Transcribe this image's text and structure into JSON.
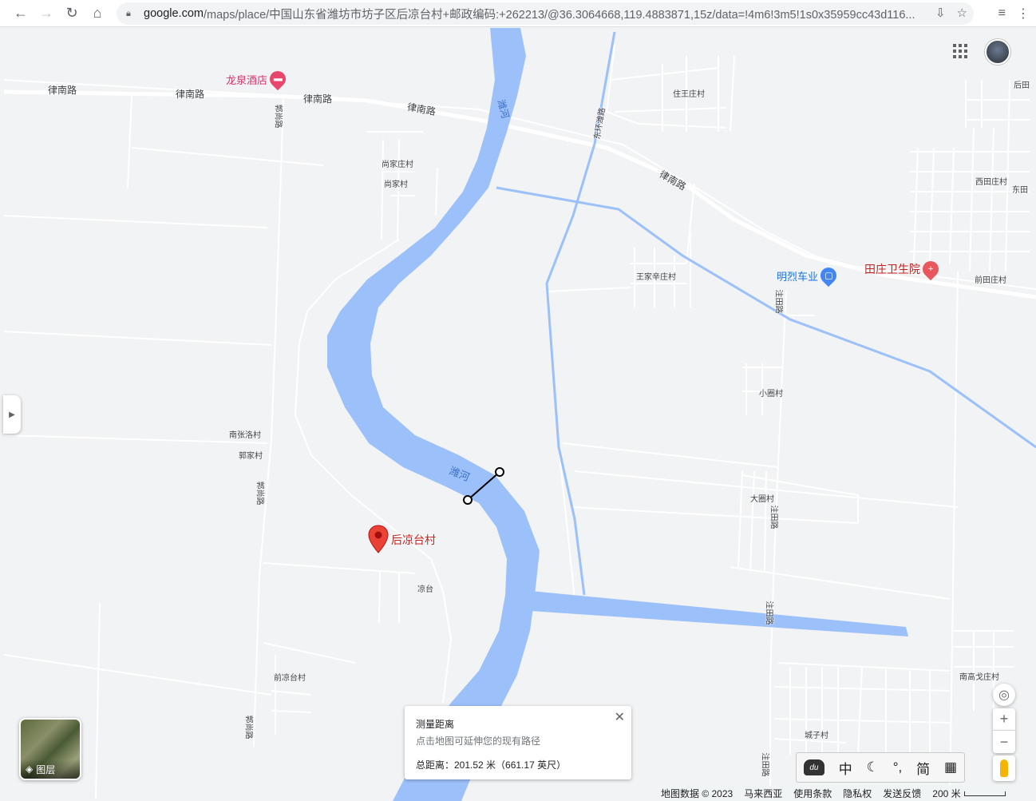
{
  "browser": {
    "url_host": "google.com",
    "url_path": "/maps/place/中国山东省潍坊市坊子区后凉台村+邮政编码:+262213/@36.3064668,119.4883871,15z/data=!4m6!3m5!1s0x35959cc43d116..."
  },
  "map": {
    "roads": {
      "lvnan_1": "律南路",
      "lvnan_2": "律南路",
      "lvnan_3": "律南路",
      "lvnan_4": "律南路",
      "lvnan_5": "律南路",
      "guoshang_1": "郭尚路",
      "guoshang_2": "郭尚路",
      "guoshang_3": "郭尚路",
      "donghuan": "东环潍路",
      "zhutian_1": "注田路",
      "zhutian_2": "注田路",
      "zhutian_3": "注田路",
      "zhutian_4": "注田路"
    },
    "water": {
      "weihe_1": "潍河",
      "weihe_2": "潍河"
    },
    "villages": {
      "zhuwangzhuang": "住王庄村",
      "shangjiazhuang": "尚家庄村",
      "shangjia": "尚家村",
      "houtian": "后田",
      "xitianzhuang": "西田庄村",
      "dongtian": "东田",
      "wangjiaxinzhuang": "王家辛庄村",
      "qiantianzhuang": "前田庄村",
      "xiaoquan": "小圈村",
      "nanzhangluo": "南张洛村",
      "guojia": "郭家村",
      "daquan": "大圈村",
      "liangtai": "凉台",
      "qianliangtai": "前凉台村",
      "nangaogezhuang": "南高戈庄村",
      "chengzi": "城子村"
    },
    "pois": {
      "longquan_hotel": "龙泉酒店",
      "minglie": "明烈车业",
      "tianzhuang_hospital": "田庄卫生院"
    },
    "selected_place": "后凉台村"
  },
  "measure": {
    "title": "测量距离",
    "hint": "点击地图可延伸您的现有路径",
    "total": "总距离：201.52 米（661.17 英尺）"
  },
  "controls": {
    "layers_label": "图层"
  },
  "ime": {
    "lang": "中",
    "punct": "°,",
    "simplified": "简"
  },
  "footer": {
    "map_data": "地图数据 © 2023",
    "region": "马来西亚",
    "terms": "使用条款",
    "privacy": "隐私权",
    "feedback": "发送反馈",
    "scale": "200 米"
  },
  "colors": {
    "water": "#9cc0f9",
    "land": "#f1f3f4",
    "road": "#ffffff",
    "pin": "#ea4335",
    "poi_hotel": "#e8476d",
    "poi_shop": "#4285f4",
    "poi_medical": "#e8565e"
  }
}
